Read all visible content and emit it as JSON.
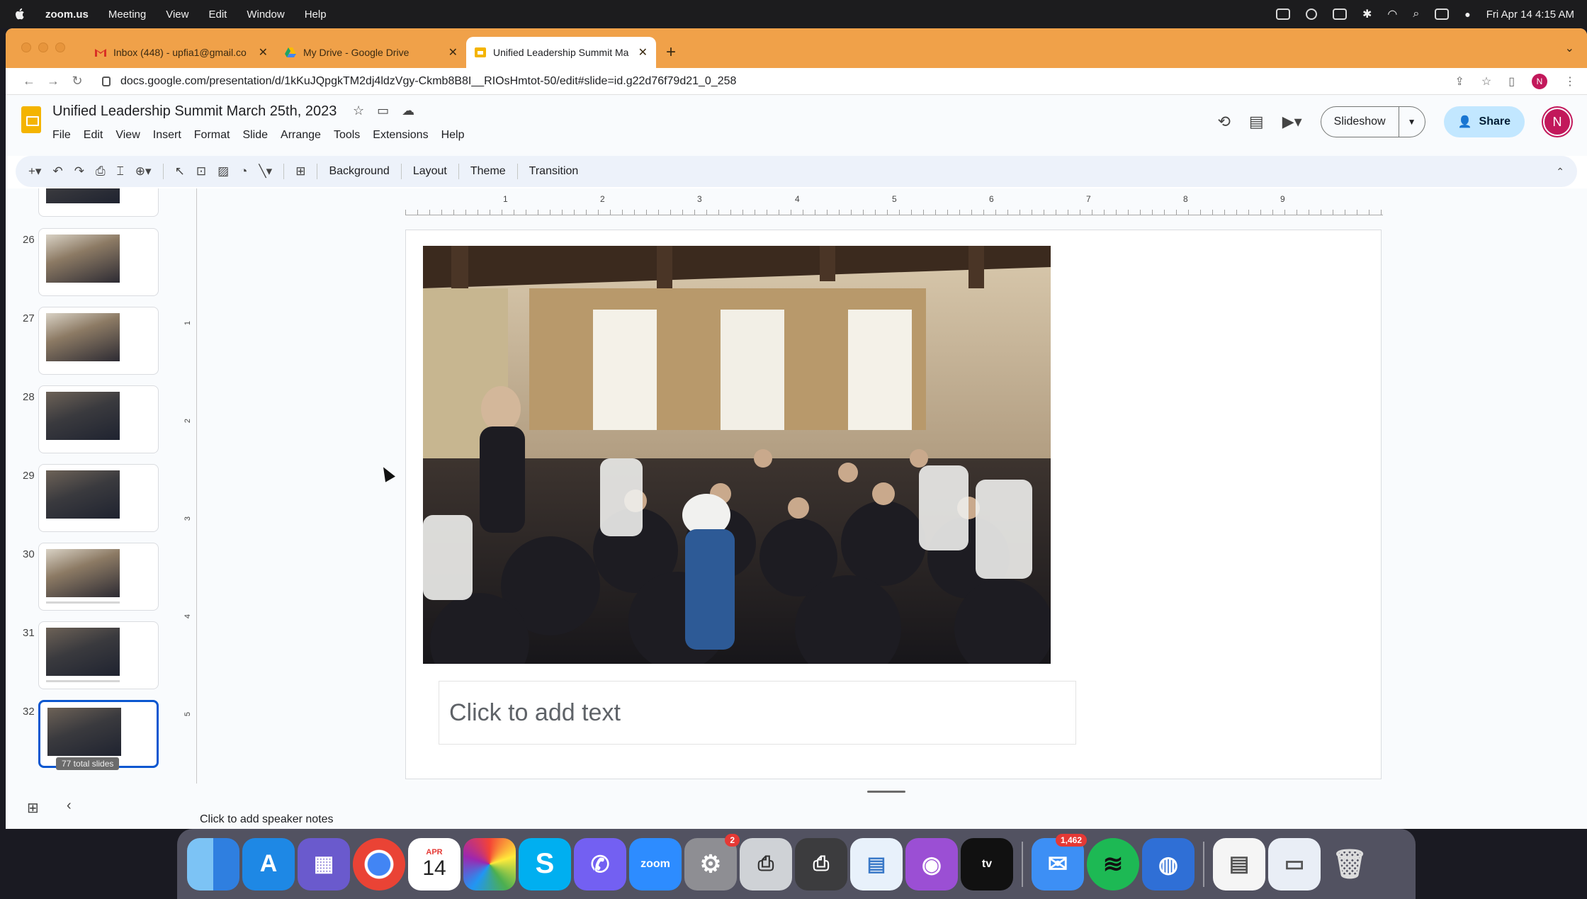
{
  "menubar": {
    "app": "zoom.us",
    "items": [
      "Meeting",
      "View",
      "Edit",
      "Window",
      "Help"
    ],
    "clock": "Fri Apr 14  4:15 AM"
  },
  "browser": {
    "tabs": [
      {
        "label": "Inbox (448) - upfia1@gmail.co",
        "icon": "gmail-icon"
      },
      {
        "label": "My Drive - Google Drive",
        "icon": "drive-icon"
      },
      {
        "label": "Unified Leadership Summit Ma",
        "icon": "slides-icon"
      }
    ],
    "url": "docs.google.com/presentation/d/1kKuJQpgkTM2dj4ldzVgy-Ckmb8B8I__RIOsHmtot-50/edit#slide=id.g22d76f79d21_0_258",
    "profile_initial": "N"
  },
  "doc": {
    "title": "Unified Leadership Summit  March 25th, 2023",
    "menu": [
      "File",
      "Edit",
      "View",
      "Insert",
      "Format",
      "Slide",
      "Arrange",
      "Tools",
      "Extensions",
      "Help"
    ],
    "slideshow_label": "Slideshow",
    "share_label": "Share",
    "avatar_initial": "N"
  },
  "toolbar": {
    "background": "Background",
    "layout": "Layout",
    "theme": "Theme",
    "transition": "Transition"
  },
  "filmstrip": {
    "slides": [
      "26",
      "27",
      "28",
      "29",
      "30",
      "31",
      "32"
    ],
    "selected": "32",
    "total_badge": "77 total slides"
  },
  "ruler": {
    "h_marks": [
      "1",
      "2",
      "3",
      "4",
      "5",
      "6",
      "7",
      "8",
      "9"
    ],
    "v_marks": [
      "1",
      "2",
      "3",
      "4",
      "5"
    ]
  },
  "slide": {
    "placeholder": "Click to add text"
  },
  "notes": {
    "placeholder": "Click to add speaker notes"
  },
  "dock": {
    "calendar_month": "APR",
    "calendar_day": "14",
    "zoom_label": "zoom",
    "system_prefs_badge": "2",
    "mail_badge": "1,462",
    "tv_label": "tv"
  }
}
